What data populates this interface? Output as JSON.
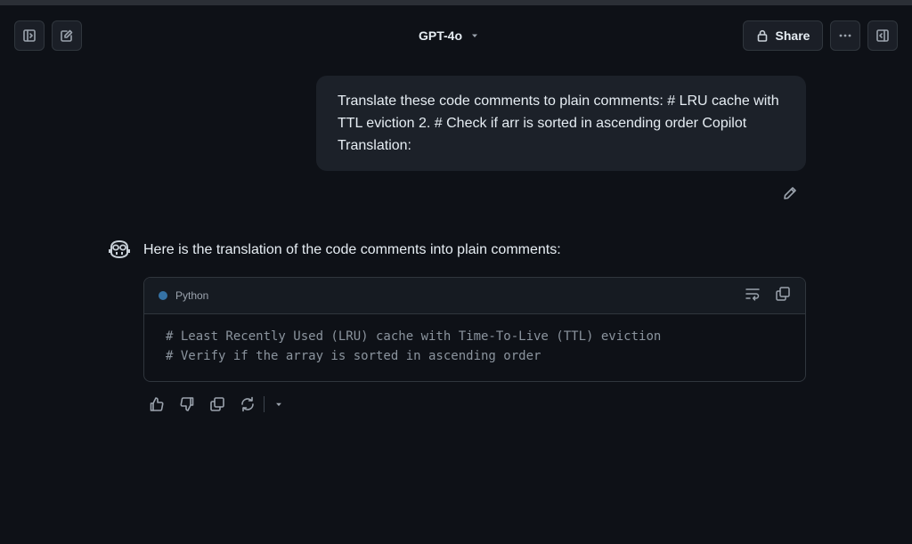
{
  "header": {
    "model_name": "GPT-4o",
    "share_label": "Share"
  },
  "conversation": {
    "user_message": "Translate these code comments to plain comments: # LRU cache with TTL eviction 2. # Check if arr is sorted in ascending order Copilot Translation:",
    "assistant_intro": "Here is the translation of the code comments into plain comments:",
    "code": {
      "language": "Python",
      "language_color": "#3572a5",
      "lines": [
        "# Least Recently Used (LRU) cache with Time-To-Live (TTL) eviction",
        "# Verify if the array is sorted in ascending order"
      ]
    }
  },
  "icons": {
    "top_left": [
      "sidebar-toggle-icon",
      "new-chat-icon"
    ],
    "top_right": [
      "lock-icon",
      "more-options-icon",
      "panel-toggle-icon"
    ],
    "code_tools": [
      "word-wrap-icon",
      "copy-icon"
    ],
    "feedback": [
      "thumbs-up-icon",
      "thumbs-down-icon",
      "copy-icon",
      "regenerate-icon",
      "chevron-down-icon"
    ]
  }
}
